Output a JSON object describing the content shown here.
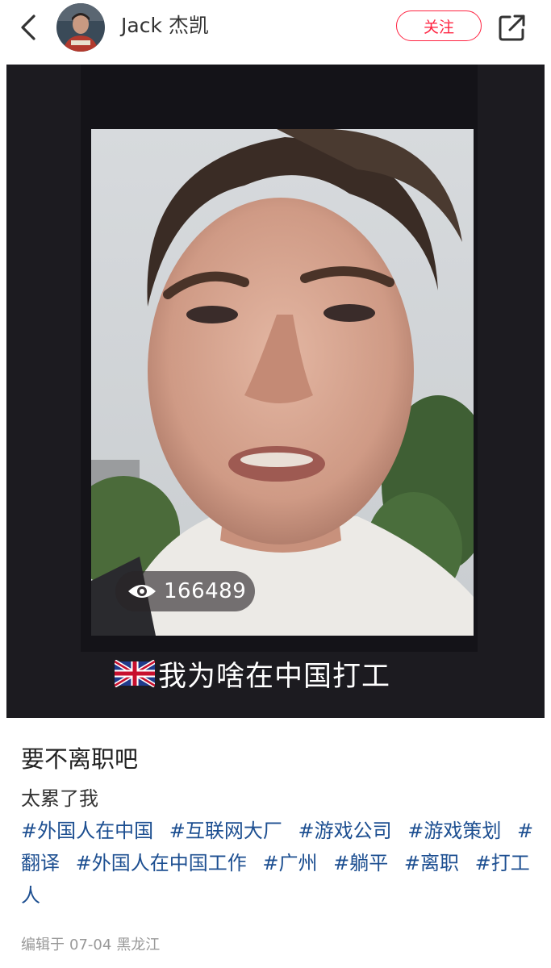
{
  "header": {
    "author_name": "Jack 杰凯",
    "follow_label": "关注"
  },
  "media": {
    "view_count": "166489",
    "caption_text": "我为啥在中国打工"
  },
  "post": {
    "title": "要不离职吧",
    "body": "太累了我",
    "tags": [
      "#外国人在中国",
      "#互联网大厂",
      "#游戏公司",
      "#游戏策划",
      "#翻译",
      "#外国人在中国工作",
      "#广州",
      "#躺平",
      "#离职",
      "#打工人"
    ],
    "edited_label": "编辑于",
    "edited_date": "07-04",
    "location": "黑龙江"
  },
  "colors": {
    "accent": "#ff2442",
    "tag": "#1d4f91",
    "media_bg": "#1c1b20"
  },
  "icons": [
    "back-arrow-icon",
    "share-icon",
    "eye-icon",
    "uk-flag-icon"
  ]
}
